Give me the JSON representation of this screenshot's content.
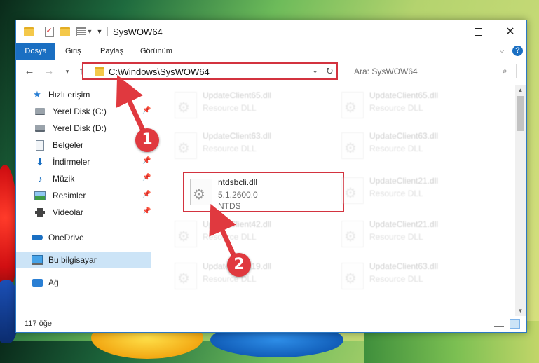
{
  "window": {
    "title": "SysWOW64"
  },
  "ribbon": {
    "tabs": [
      "Dosya",
      "Giriş",
      "Paylaş",
      "Görünüm"
    ],
    "accent": "#1a6fc2",
    "help_label": "?"
  },
  "navbar": {
    "address": "C:\\Windows\\SysWOW64",
    "search_placeholder": "Ara: SysWOW64"
  },
  "sidebar": {
    "items": [
      {
        "label": "Hızlı erişim",
        "icon": "star-icon",
        "pinned": false
      },
      {
        "label": "Yerel Disk (C:)",
        "icon": "disk-icon",
        "pinned": true
      },
      {
        "label": "Yerel Disk (D:)",
        "icon": "disk-icon",
        "pinned": false
      },
      {
        "label": "Belgeler",
        "icon": "documents-icon",
        "pinned": false
      },
      {
        "label": "İndirmeler",
        "icon": "download-icon",
        "pinned": true
      },
      {
        "label": "Müzik",
        "icon": "music-icon",
        "pinned": true
      },
      {
        "label": "Resimler",
        "icon": "pictures-icon",
        "pinned": true
      },
      {
        "label": "Videolar",
        "icon": "videos-icon",
        "pinned": true
      },
      {
        "label": "OneDrive",
        "icon": "onedrive-icon",
        "pinned": false
      },
      {
        "label": "Bu bilgisayar",
        "icon": "computer-icon",
        "pinned": false,
        "selected": true
      },
      {
        "label": "Ağ",
        "icon": "network-icon",
        "pinned": false
      }
    ]
  },
  "files": [
    {
      "name": "UpdateClient65.dll",
      "type": "Resource DLL",
      "faded": true
    },
    {
      "name": "UpdateClient65.dll",
      "type": "Resource DLL",
      "faded": true
    },
    {
      "name": "UpdateClient63.dll",
      "type": "Resource DLL",
      "faded": true
    },
    {
      "name": "UpdateClient63.dll",
      "type": "Resource DLL",
      "faded": true
    },
    {
      "name": "ntdsbcli.dll",
      "version": "5.1.2600.0",
      "type": "NTDS",
      "highlighted": true
    },
    {
      "name": "UpdateClient21.dll",
      "type": "Resource DLL",
      "faded": true
    },
    {
      "name": "UpdateClient42.dll",
      "type": "Resource DLL",
      "faded": true
    },
    {
      "name": "UpdateClient21.dll",
      "type": "Resource DLL",
      "faded": true
    },
    {
      "name": "UpdateClient19.dll",
      "type": "Resource DLL",
      "faded": true
    },
    {
      "name": "UpdateClient63.dll",
      "type": "Resource DLL",
      "faded": true
    }
  ],
  "status": {
    "item_count": "117 öğe"
  },
  "annotations": {
    "step1": "1",
    "step2": "2",
    "color": "#e0393f"
  }
}
